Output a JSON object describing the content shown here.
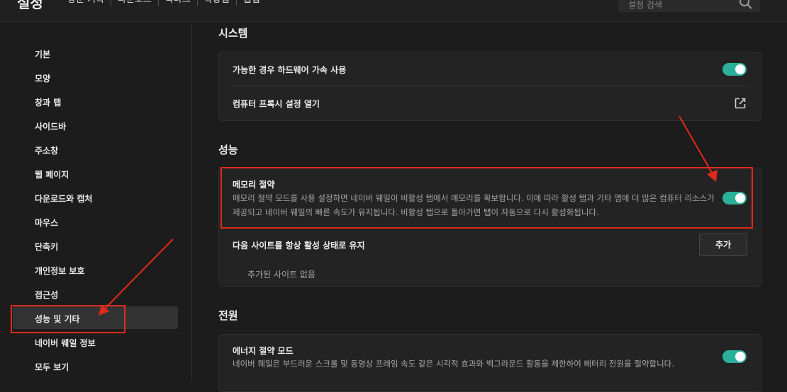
{
  "header": {
    "title": "설정",
    "tabs": [
      "방문 기록",
      "다운로드",
      "북마크",
      "확장앱",
      "웹앱"
    ],
    "search_placeholder": "설정 검색"
  },
  "sidebar": {
    "items": [
      {
        "label": "기본"
      },
      {
        "label": "모양"
      },
      {
        "label": "창과 탭"
      },
      {
        "label": "사이드바"
      },
      {
        "label": "주소창"
      },
      {
        "label": "웹 페이지"
      },
      {
        "label": "다운로드와 캡처"
      },
      {
        "label": "마우스"
      },
      {
        "label": "단축키"
      },
      {
        "label": "개인정보 보호"
      },
      {
        "label": "접근성"
      },
      {
        "label": "성능 및 기타",
        "active": true
      },
      {
        "label": "네이버 웨일 정보"
      },
      {
        "label": "모두 보기"
      }
    ]
  },
  "sections": {
    "system": {
      "title": "시스템",
      "hardware_accel": {
        "label": "가능한 경우 하드웨어 가속 사용",
        "enabled": true
      },
      "proxy": {
        "label": "컴퓨터 프록시 설정 열기",
        "icon": "external-link-icon"
      }
    },
    "performance": {
      "title": "성능",
      "memory_saver": {
        "label": "메모리 절약",
        "description": "메모리 절약 모드를 사용 설정하면 네이버 웨일이 비활성 탭에서 메모리를 확보합니다. 이에 따라 활성 탭과 기타 앱에 더 많은 컴퓨터 리소스가 제공되고 네이버 웨일의 빠른 속도가 유지됩니다. 비활성 탭으로 돌아가면 탭이 자동으로 다시 활성화됩니다.",
        "enabled": true
      },
      "always_active": {
        "label": "다음 사이트를 항상 활성 상태로 유지",
        "add_button": "추가",
        "empty_text": "추가된 사이트 없음"
      }
    },
    "power": {
      "title": "전원",
      "energy_saver": {
        "label": "에너지 절약 모드",
        "description": "네이버 웨일은 부드러운 스크롤 및 동영상 프레임 속도 같은 시각적 효과와 백그라운드 활동을 제한하여 배터리 전원을 절약합니다.",
        "enabled": true
      }
    }
  },
  "colors": {
    "accent_toggle": "#2bb19a",
    "annotation": "#e12a1b",
    "background": "#1c1c1c",
    "card": "#232323"
  }
}
